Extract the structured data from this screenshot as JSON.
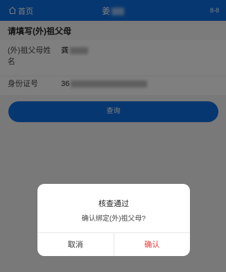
{
  "header": {
    "home_label": "首页",
    "title": "姜",
    "right_text": "8-8"
  },
  "form": {
    "section_title": "请填写(外)祖父母",
    "name_label": "(外)祖父母姓名",
    "name_value": "龚",
    "id_label": "身份证号",
    "id_value": "36"
  },
  "query_button": "查询",
  "dialog": {
    "title": "核查通过",
    "message": "确认绑定(外)祖父母?",
    "cancel": "取消",
    "confirm": "确认"
  },
  "colors": {
    "primary": "#0f6fe0",
    "confirm": "#e23a3a"
  }
}
